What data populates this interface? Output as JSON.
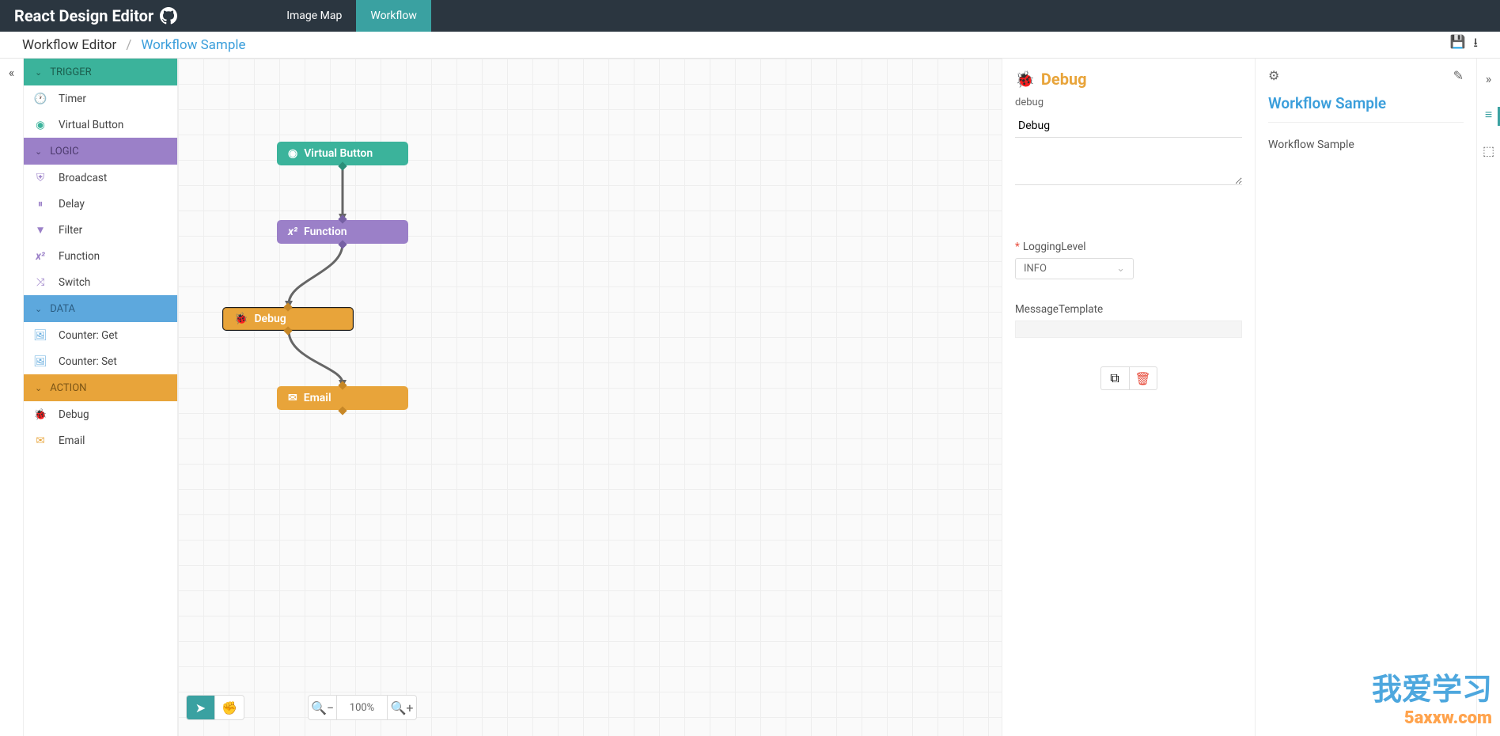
{
  "brand": "React Design Editor",
  "nav": {
    "imagemap": "Image Map",
    "workflow": "Workflow"
  },
  "breadcrumb": {
    "editor": "Workflow Editor",
    "current": "Workflow Sample"
  },
  "sidebar": {
    "groups": {
      "trigger": "TRIGGER",
      "logic": "LOGIC",
      "data": "DATA",
      "action": "ACTION"
    },
    "items": {
      "timer": "Timer",
      "virtual_button": "Virtual Button",
      "broadcast": "Broadcast",
      "delay": "Delay",
      "filter": "Filter",
      "function": "Function",
      "switch": "Switch",
      "counter_get": "Counter: Get",
      "counter_set": "Counter: Set",
      "debug": "Debug",
      "email": "Email"
    }
  },
  "canvas": {
    "nodes": {
      "n1": "Virtual Button",
      "n2": "Function",
      "n3": "Debug",
      "n4": "Email"
    },
    "zoom": "100%"
  },
  "inspector": {
    "title": "Debug",
    "subtype": "debug",
    "name_value": "Debug",
    "logging_label": "LoggingLevel",
    "logging_value": "INFO",
    "mt_label": "MessageTemplate"
  },
  "outline": {
    "title": "Workflow Sample",
    "item": "Workflow Sample"
  },
  "watermark": {
    "main": "我爱学习",
    "sub": "5axxw.com"
  }
}
